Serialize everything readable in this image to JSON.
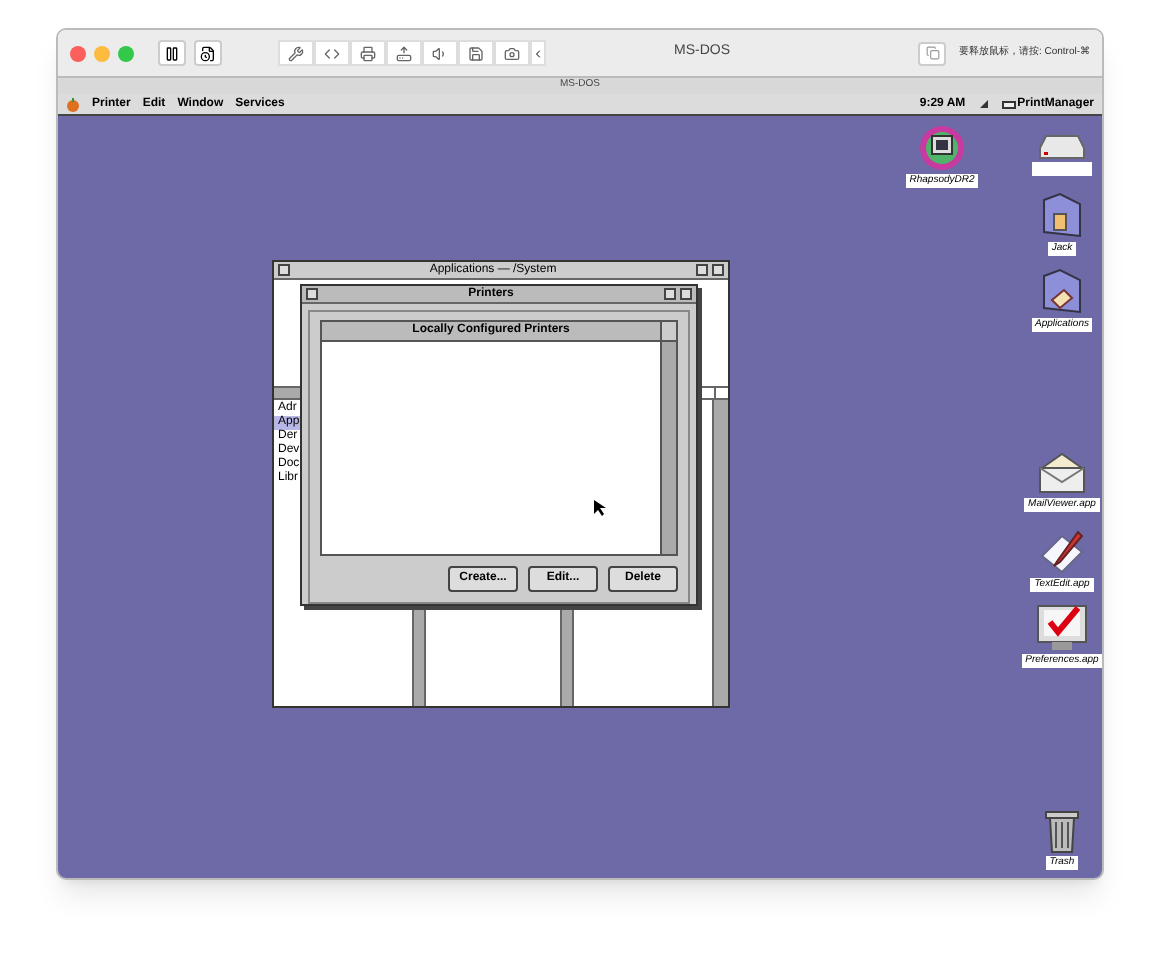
{
  "host_window": {
    "title": "MS-DOS",
    "hint": "要释放鼠标，请按: Control-⌘",
    "subtitle": "MS-DOS"
  },
  "menu_bar": {
    "items": [
      "Printer",
      "Edit",
      "Window",
      "Services"
    ],
    "clock": "9:29 AM",
    "app_name": "PrintManager"
  },
  "applications_window": {
    "title": "Applications — /System",
    "browser_items": [
      {
        "label": "Adr",
        "selected": false
      },
      {
        "label": "App",
        "selected": true
      },
      {
        "label": "Der",
        "selected": false
      },
      {
        "label": "Dev",
        "selected": false
      },
      {
        "label": "Doc",
        "selected": false
      },
      {
        "label": "Libr",
        "selected": false
      }
    ]
  },
  "printers_window": {
    "title": "Printers",
    "list_header": "Locally Configured Printers",
    "buttons": [
      "Create...",
      "Edit...",
      "Delete"
    ]
  },
  "desktop_icons": [
    {
      "kind": "app",
      "label": "RhapsodyDR2"
    },
    {
      "kind": "disk"
    },
    {
      "kind": "home",
      "label": "Jack"
    },
    {
      "kind": "apps",
      "label": "Applications"
    },
    {
      "kind": "mail",
      "label": "MailViewer.app"
    },
    {
      "kind": "edit",
      "label": "TextEdit.app"
    },
    {
      "kind": "prefs",
      "label": "Preferences.app"
    },
    {
      "kind": "trash",
      "label": "Trash"
    }
  ]
}
